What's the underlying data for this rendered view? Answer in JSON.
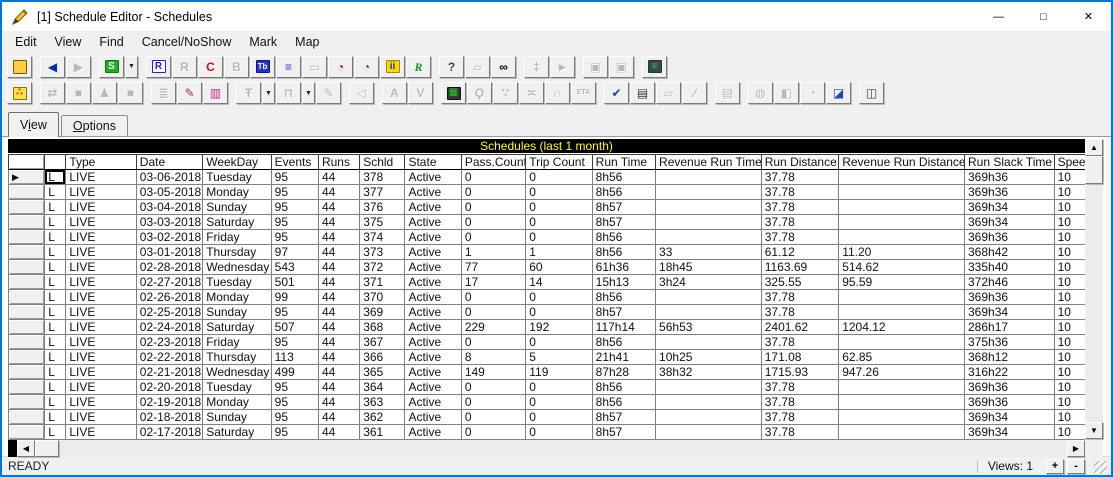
{
  "window": {
    "title": "[1] Schedule Editor - Schedules",
    "controls": {
      "minimize": "—",
      "maximize": "□",
      "close": "✕"
    }
  },
  "colors": {
    "accent_border": "#0078d7",
    "grid_title_bg": "#000000",
    "grid_title_fg": "#ffff00"
  },
  "menu": [
    "Edit",
    "View",
    "Find",
    "Cancel/NoShow",
    "Mark",
    "Map"
  ],
  "toolbar_dropdown_glyph": "▼",
  "toolbar_main": {
    "items": [
      {
        "name": "exit-door-icon",
        "glyph": "",
        "bg": "#ffcf3f",
        "bd": "#7a5c00",
        "enabled": true,
        "rect": true
      },
      {
        "sep": true
      },
      {
        "name": "back-icon",
        "glyph": "◀",
        "fg": "#0a2ea8",
        "enabled": true
      },
      {
        "name": "forward-icon",
        "glyph": "▶",
        "enabled": false
      },
      {
        "sep": true
      },
      {
        "name": "schedules-s-icon",
        "glyph": "S",
        "fg": "#ffffff",
        "bg": "#1faf1f",
        "bd": "#0d7a0d",
        "enabled": true
      },
      {
        "name": "schedules-dropdown-icon",
        "glyph": "▼",
        "enabled": true,
        "droponly": true
      },
      {
        "sep": true
      },
      {
        "name": "runs-r-icon",
        "glyph": "R",
        "fg": "#2222dd",
        "bg": "#ffffff",
        "bd": "#2222dd",
        "enabled": true
      },
      {
        "name": "runs-list-icon",
        "glyph": "R",
        "enabled": false
      },
      {
        "name": "cancel-list-icon",
        "glyph": "C",
        "fg": "#cc1111",
        "enabled": true
      },
      {
        "name": "block-b-icon",
        "glyph": "B",
        "enabled": false
      },
      {
        "name": "timetable-tb-icon",
        "glyph": "Tb",
        "fg": "#ffffff",
        "bg": "#2233cc",
        "bd": "#111188",
        "enabled": true,
        "small": true
      },
      {
        "name": "event-list-icon",
        "glyph": "≡",
        "fg": "#2244dd",
        "enabled": true
      },
      {
        "name": "bus-icon",
        "glyph": "▭",
        "enabled": false
      },
      {
        "name": "alarm-clock-icon",
        "glyph": "◔",
        "fg": "#cc0000",
        "enabled": true
      },
      {
        "name": "clock-window-icon",
        "glyph": "◔",
        "fg": "#444444",
        "enabled": true
      },
      {
        "name": "crew-icon",
        "glyph": "ii",
        "fg": "#2233aa",
        "bg": "#ffd700",
        "bd": "#aa8800",
        "enabled": true
      },
      {
        "name": "script-r-icon",
        "glyph": "R",
        "fg": "#119933",
        "enabled": true,
        "italic": true
      },
      {
        "sep": true
      },
      {
        "name": "help-icon",
        "glyph": "?",
        "fg": "#444444",
        "enabled": true
      },
      {
        "name": "car-icon",
        "glyph": "▱",
        "enabled": false
      },
      {
        "name": "binoculars-icon",
        "glyph": "∞",
        "fg": "#000000",
        "enabled": true
      },
      {
        "sep": true
      },
      {
        "name": "gauge-icon",
        "glyph": "‡",
        "enabled": false
      },
      {
        "name": "flag-icon",
        "glyph": "►",
        "enabled": false
      },
      {
        "sep": true
      },
      {
        "name": "vehicle-block-a-icon",
        "glyph": "▣",
        "enabled": false
      },
      {
        "name": "vehicle-block-b-icon",
        "glyph": "▣",
        "enabled": false
      },
      {
        "sep": true
      },
      {
        "name": "radio-console-icon",
        "glyph": "≡",
        "fg": "#33cc33",
        "bg": "#3a4a4a",
        "bd": "#223333",
        "enabled": true
      }
    ]
  },
  "toolbar_secondary": {
    "items": [
      {
        "name": "waste-bucket-icon",
        "glyph": "∴",
        "fg": "#c03030",
        "bg": "#ffe03f",
        "bd": "#8a7500",
        "enabled": true
      },
      {
        "sep": true
      },
      {
        "name": "fit-arrows-icon",
        "glyph": "⇄",
        "enabled": false
      },
      {
        "name": "gray-block-a-icon",
        "glyph": "■",
        "enabled": false
      },
      {
        "name": "person-icon",
        "glyph": "♟",
        "enabled": false
      },
      {
        "name": "gray-block-b-icon",
        "glyph": "■",
        "enabled": false
      },
      {
        "sep": true
      },
      {
        "name": "time-list-icon",
        "glyph": "≣",
        "enabled": false
      },
      {
        "name": "paintbrush-icon",
        "glyph": "✎",
        "fg": "#b03060",
        "enabled": true
      },
      {
        "name": "card-printer-icon",
        "glyph": "▥",
        "fg": "#cc2288",
        "enabled": true
      },
      {
        "sep": true
      },
      {
        "name": "no-text-icon",
        "glyph": "Ŧ",
        "enabled": false,
        "drop": true
      },
      {
        "name": "dock-layout-icon",
        "glyph": "⊓",
        "enabled": false,
        "drop": true
      },
      {
        "name": "edit-pencil-icon",
        "glyph": "✎",
        "enabled": false
      },
      {
        "sep": true
      },
      {
        "name": "speaker-icon",
        "glyph": "◁",
        "enabled": false
      },
      {
        "sep": true
      },
      {
        "name": "text-doc-a-icon",
        "glyph": "A",
        "enabled": false
      },
      {
        "name": "text-doc-v-icon",
        "glyph": "V",
        "enabled": false
      },
      {
        "sep": true
      },
      {
        "name": "console-monitor-icon",
        "glyph": "▦",
        "fg": "#22cc22",
        "bg": "#333333",
        "bd": "#111111",
        "enabled": true
      },
      {
        "name": "magnifier-icon",
        "glyph": "Ϙ",
        "enabled": false
      },
      {
        "name": "footprints-icon",
        "glyph": "∵",
        "enabled": false
      },
      {
        "name": "ruler-icon",
        "glyph": "≍",
        "enabled": false
      },
      {
        "name": "tunnel-icon",
        "glyph": "∩",
        "enabled": false
      },
      {
        "name": "eta-icon",
        "glyph": "ETA",
        "enabled": false,
        "tiny": true
      },
      {
        "sep": true
      },
      {
        "name": "checklist-icon",
        "glyph": "✔",
        "fg": "#1144cc",
        "enabled": true
      },
      {
        "name": "printer-icon",
        "glyph": "▤",
        "fg": "#333333",
        "enabled": true
      },
      {
        "name": "car-2-icon",
        "glyph": "▱",
        "enabled": false
      },
      {
        "name": "pointer-wand-icon",
        "glyph": "∕",
        "enabled": false
      },
      {
        "sep": true
      },
      {
        "name": "notepad-icon",
        "glyph": "▤",
        "enabled": false
      },
      {
        "sep": true
      },
      {
        "name": "bell-tag-icon",
        "glyph": "◍",
        "enabled": false
      },
      {
        "name": "monitor-tag-icon",
        "glyph": "◧",
        "enabled": false
      },
      {
        "name": "clock-circle-icon",
        "glyph": "◔",
        "enabled": false
      },
      {
        "name": "graph-monitor-icon",
        "glyph": "◪",
        "fg": "#2244bb",
        "enabled": true
      },
      {
        "sep": true
      },
      {
        "name": "book-icon",
        "glyph": "◫",
        "fg": "#404040",
        "enabled": true
      }
    ]
  },
  "tabs": [
    {
      "label": "View",
      "accel_index": 1,
      "active": true
    },
    {
      "label": "Options",
      "accel_index": 0,
      "active": false
    }
  ],
  "grid": {
    "title": "Schedules (last 1 month)",
    "selection_marker": "▶",
    "selected_row": 0,
    "columns": [
      "",
      "",
      "Type",
      "Date",
      "WeekDay",
      "Events",
      "Runs",
      "Schld",
      "State",
      "Pass.Count",
      "Trip Count",
      "Run Time",
      "Revenue Run Time",
      "Run Distance",
      "Revenue Run Distance",
      "Run Slack Time",
      "Speed"
    ],
    "rows": [
      [
        "L",
        "LIVE",
        "03-06-2018",
        "Tuesday",
        "95",
        "44",
        "378",
        "Active",
        "0",
        "0",
        "8h56",
        "",
        "37.78",
        "",
        "369h36",
        "10"
      ],
      [
        "L",
        "LIVE",
        "03-05-2018",
        "Monday",
        "95",
        "44",
        "377",
        "Active",
        "0",
        "0",
        "8h56",
        "",
        "37.78",
        "",
        "369h36",
        "10"
      ],
      [
        "L",
        "LIVE",
        "03-04-2018",
        "Sunday",
        "95",
        "44",
        "376",
        "Active",
        "0",
        "0",
        "8h57",
        "",
        "37.78",
        "",
        "369h34",
        "10"
      ],
      [
        "L",
        "LIVE",
        "03-03-2018",
        "Saturday",
        "95",
        "44",
        "375",
        "Active",
        "0",
        "0",
        "8h57",
        "",
        "37.78",
        "",
        "369h34",
        "10"
      ],
      [
        "L",
        "LIVE",
        "03-02-2018",
        "Friday",
        "95",
        "44",
        "374",
        "Active",
        "0",
        "0",
        "8h56",
        "",
        "37.78",
        "",
        "369h36",
        "10"
      ],
      [
        "L",
        "LIVE",
        "03-01-2018",
        "Thursday",
        "97",
        "44",
        "373",
        "Active",
        "1",
        "1",
        "8h56",
        "33",
        "61.12",
        "11.20",
        "368h42",
        "10"
      ],
      [
        "L",
        "LIVE",
        "02-28-2018",
        "Wednesday",
        "543",
        "44",
        "372",
        "Active",
        "77",
        "60",
        "61h36",
        "18h45",
        "1163.69",
        "514.62",
        "335h40",
        "10"
      ],
      [
        "L",
        "LIVE",
        "02-27-2018",
        "Tuesday",
        "501",
        "44",
        "371",
        "Active",
        "17",
        "14",
        "15h13",
        "3h24",
        "325.55",
        "95.59",
        "372h46",
        "10"
      ],
      [
        "L",
        "LIVE",
        "02-26-2018",
        "Monday",
        "99",
        "44",
        "370",
        "Active",
        "0",
        "0",
        "8h56",
        "",
        "37.78",
        "",
        "369h36",
        "10"
      ],
      [
        "L",
        "LIVE",
        "02-25-2018",
        "Sunday",
        "95",
        "44",
        "369",
        "Active",
        "0",
        "0",
        "8h57",
        "",
        "37.78",
        "",
        "369h34",
        "10"
      ],
      [
        "L",
        "LIVE",
        "02-24-2018",
        "Saturday",
        "507",
        "44",
        "368",
        "Active",
        "229",
        "192",
        "117h14",
        "56h53",
        "2401.62",
        "1204.12",
        "286h17",
        "10"
      ],
      [
        "L",
        "LIVE",
        "02-23-2018",
        "Friday",
        "95",
        "44",
        "367",
        "Active",
        "0",
        "0",
        "8h56",
        "",
        "37.78",
        "",
        "375h36",
        "10"
      ],
      [
        "L",
        "LIVE",
        "02-22-2018",
        "Thursday",
        "113",
        "44",
        "366",
        "Active",
        "8",
        "5",
        "21h41",
        "10h25",
        "171.08",
        "62.85",
        "368h12",
        "10"
      ],
      [
        "L",
        "LIVE",
        "02-21-2018",
        "Wednesday",
        "499",
        "44",
        "365",
        "Active",
        "149",
        "119",
        "87h28",
        "38h32",
        "1715.93",
        "947.26",
        "316h22",
        "10"
      ],
      [
        "L",
        "LIVE",
        "02-20-2018",
        "Tuesday",
        "95",
        "44",
        "364",
        "Active",
        "0",
        "0",
        "8h56",
        "",
        "37.78",
        "",
        "369h36",
        "10"
      ],
      [
        "L",
        "LIVE",
        "02-19-2018",
        "Monday",
        "95",
        "44",
        "363",
        "Active",
        "0",
        "0",
        "8h56",
        "",
        "37.78",
        "",
        "369h36",
        "10"
      ],
      [
        "L",
        "LIVE",
        "02-18-2018",
        "Sunday",
        "95",
        "44",
        "362",
        "Active",
        "0",
        "0",
        "8h57",
        "",
        "37.78",
        "",
        "369h34",
        "10"
      ],
      [
        "L",
        "LIVE",
        "02-17-2018",
        "Saturday",
        "95",
        "44",
        "361",
        "Active",
        "0",
        "0",
        "8h57",
        "",
        "37.78",
        "",
        "369h34",
        "10"
      ]
    ]
  },
  "scrollbars": {
    "up": "▲",
    "down": "▼",
    "left": "◀",
    "right": "▶"
  },
  "statusbar": {
    "ready": "READY",
    "views_label": "Views:",
    "views_value": "1",
    "zoom_in": "+",
    "zoom_out": "-"
  }
}
